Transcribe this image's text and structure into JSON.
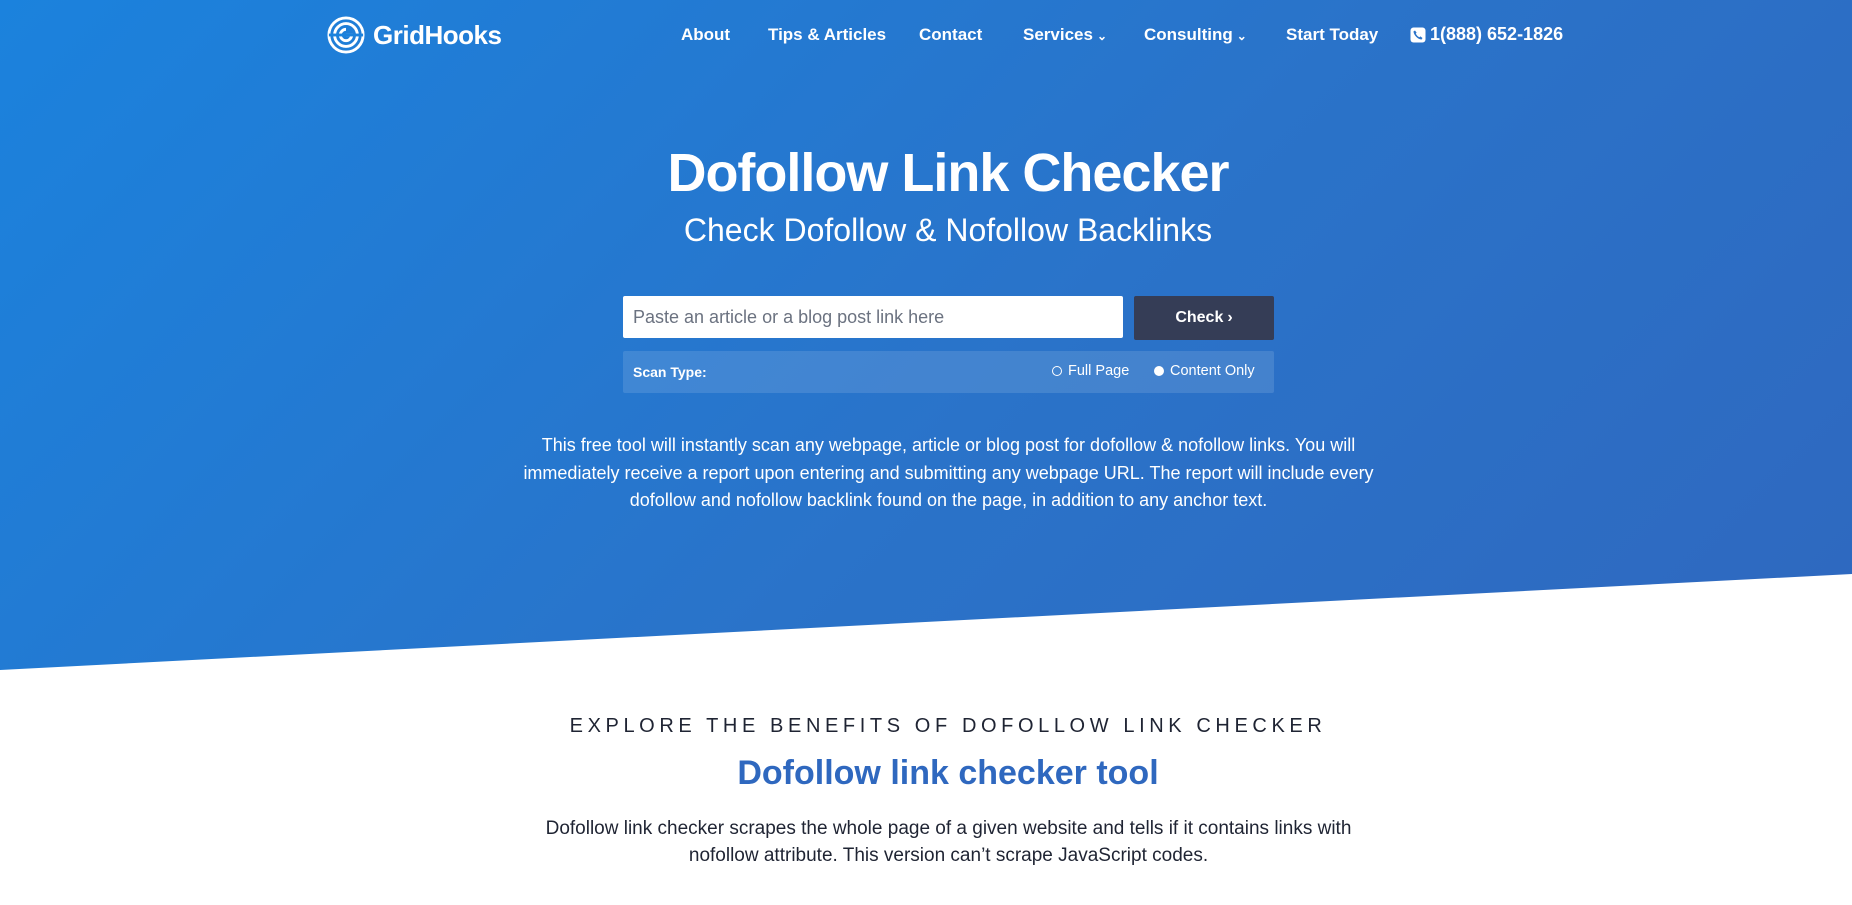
{
  "brand": {
    "name": "GridHooks",
    "logo_icon": "gridhooks-logo-icon"
  },
  "nav": {
    "items": [
      {
        "label": "About"
      },
      {
        "label": "Tips & Articles"
      },
      {
        "label": "Contact"
      },
      {
        "label": "Services",
        "dropdown": true
      },
      {
        "label": "Consulting",
        "dropdown": true
      },
      {
        "label": "Start Today"
      }
    ],
    "phone": {
      "icon": "phone-icon",
      "label": "1(888) 652-1826"
    },
    "chevron": "⌄"
  },
  "hero": {
    "title": "Dofollow Link Checker",
    "subtitle": "Check Dofollow & Nofollow Backlinks",
    "input_placeholder": "Paste an article or a blog post link here",
    "input_value": "",
    "check_button": "Check",
    "check_chevron": "›",
    "scan": {
      "label": "Scan Type:",
      "options": [
        {
          "label": "Full Page",
          "selected": false
        },
        {
          "label": "Content Only",
          "selected": true
        }
      ]
    },
    "description": "This free tool will instantly scan any webpage, article or blog post for dofollow & nofollow links. You will immediately receive a report upon entering and submitting any webpage URL. The report will include every dofollow and nofollow backlink found on the page, in addition to any anchor text."
  },
  "benefits": {
    "eyebrow": "EXPLORE THE BENEFITS OF DOFOLLOW LINK CHECKER",
    "title": "Dofollow link checker tool",
    "text": "Dofollow link checker scrapes the whole page of a given website and tells if it contains links with nofollow attribute. This version can’t scrape JavaScript codes."
  },
  "colors": {
    "hero_gradient_start": "#1b82dd",
    "hero_gradient_end": "#2f68bf",
    "button": "#353d56",
    "section_title": "#2f68bf",
    "text_dark": "#1f2433"
  }
}
